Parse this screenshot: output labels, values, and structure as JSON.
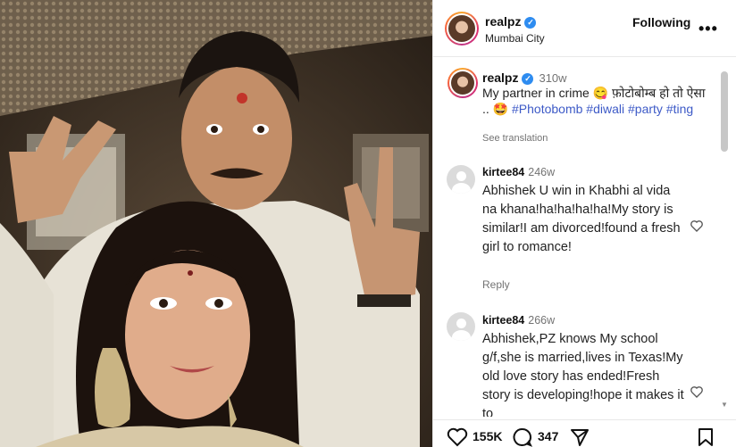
{
  "post": {
    "username": "realpz",
    "location": "Mumbai City",
    "follow_label": "Following",
    "caption": {
      "username": "realpz",
      "time": "310w",
      "text_lead": "My partner in crime 😋 फ़ोटोबोम्ब हो तो ऐसा .. 🤩",
      "hashtags": [
        "#Photobomb",
        "#diwali",
        "#party",
        "#ting"
      ],
      "see_translation": "See translation"
    }
  },
  "comments": [
    {
      "username": "kirtee84",
      "time": "246w",
      "text": "Abhishek U win in Khabhi al vida na khana!ha!ha!ha!ha!My story is similar!I am divorced!found a fresh girl to romance!",
      "reply_label": "Reply"
    },
    {
      "username": "kirtee84",
      "time": "266w",
      "text": "Abhishek,PZ knows My school g/f,she is married,lives in Texas!My old love story has ended!Fresh story is developing!hope it makes it to",
      "reply_label": ""
    }
  ],
  "actions": {
    "likes": "155K",
    "comments": "347"
  },
  "icons": {
    "verified": "verified-badge-icon",
    "more": "more-options-icon",
    "like": "heart-icon",
    "comment": "comment-bubble-icon",
    "share": "paper-plane-icon",
    "save": "bookmark-icon"
  },
  "colors": {
    "hashtag": "#3d5ac7",
    "verified": "#2e8cf0",
    "muted": "#737373"
  }
}
